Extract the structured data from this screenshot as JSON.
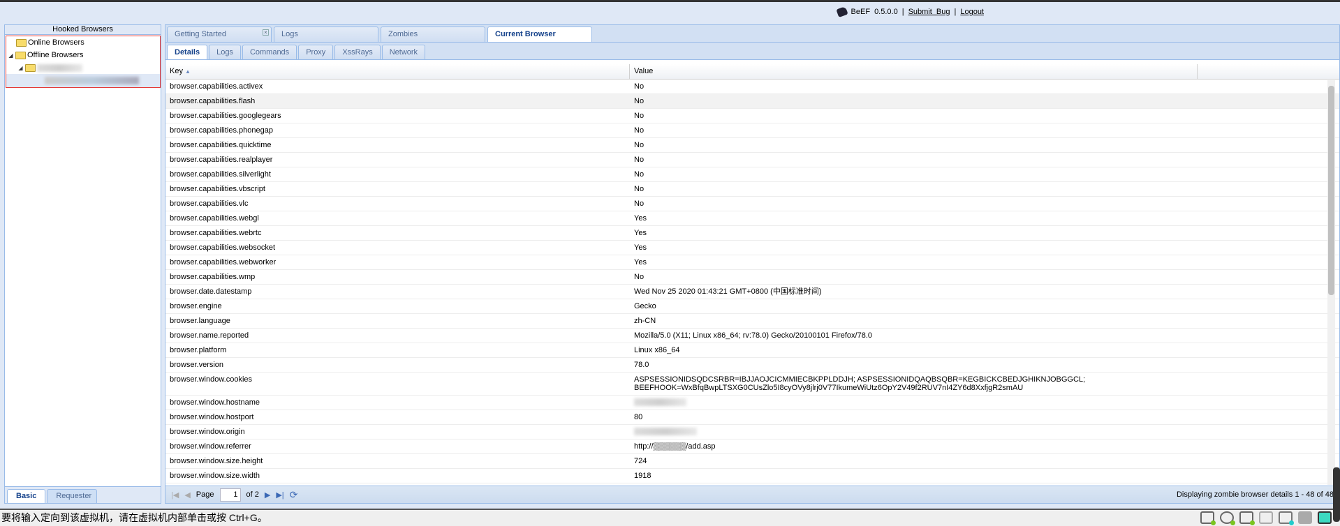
{
  "header": {
    "app": "BeEF",
    "version": "0.5.0.0",
    "submit_bug": "Submit  Bug",
    "logout": "Logout",
    "separator": "|"
  },
  "left": {
    "title": "Hooked Browsers",
    "tree": [
      {
        "label": "Online Browsers",
        "icon": "folder-icon"
      },
      {
        "label": "Offline Browsers",
        "icon": "folder-icon",
        "expanded": true
      }
    ],
    "tabs": [
      "Basic",
      "Requester"
    ]
  },
  "tabs": [
    "Getting Started",
    "Logs",
    "Zombies",
    "Current Browser"
  ],
  "subtabs": [
    "Details",
    "Logs",
    "Commands",
    "Proxy",
    "XssRays",
    "Network"
  ],
  "grid": {
    "columns": [
      "Key",
      "Value"
    ],
    "sort": "Key ascending",
    "rows": [
      [
        "browser.capabilities.activex",
        "No"
      ],
      [
        "browser.capabilities.flash",
        "No"
      ],
      [
        "browser.capabilities.googlegears",
        "No"
      ],
      [
        "browser.capabilities.phonegap",
        "No"
      ],
      [
        "browser.capabilities.quicktime",
        "No"
      ],
      [
        "browser.capabilities.realplayer",
        "No"
      ],
      [
        "browser.capabilities.silverlight",
        "No"
      ],
      [
        "browser.capabilities.vbscript",
        "No"
      ],
      [
        "browser.capabilities.vlc",
        "No"
      ],
      [
        "browser.capabilities.webgl",
        "Yes"
      ],
      [
        "browser.capabilities.webrtc",
        "Yes"
      ],
      [
        "browser.capabilities.websocket",
        "Yes"
      ],
      [
        "browser.capabilities.webworker",
        "Yes"
      ],
      [
        "browser.capabilities.wmp",
        "No"
      ],
      [
        "browser.date.datestamp",
        "Wed Nov 25 2020 01:43:21 GMT+0800 (中国标准时间)"
      ],
      [
        "browser.engine",
        "Gecko"
      ],
      [
        "browser.language",
        "zh-CN"
      ],
      [
        "browser.name.reported",
        "Mozilla/5.0 (X11; Linux x86_64; rv:78.0) Gecko/20100101 Firefox/78.0"
      ],
      [
        "browser.platform",
        "Linux x86_64"
      ],
      [
        "browser.version",
        "78.0"
      ],
      [
        "browser.window.cookies",
        "ASPSESSIONIDSQDCSRBR=IBJJAOJCICMMIECBKPPLDDJH; ASPSESSIONIDQAQBSQBR=KEGBICKCBEDJGHIKNJOBGGCL; BEEFHOOK=WxBfqBwpLTSXG0CUsZlo5I8cyOVy8jlrj0V77IkumeWiUtz6OpY2V49f2RUV7nI4ZY6d8XxfjgR2smAU"
      ],
      [
        "browser.window.hostname",
        ""
      ],
      [
        "browser.window.hostport",
        "80"
      ],
      [
        "browser.window.origin",
        ""
      ],
      [
        "browser.window.referrer",
        "http://▒▒▒▒▒▒/add.asp"
      ],
      [
        "browser.window.size.height",
        "724"
      ],
      [
        "browser.window.size.width",
        "1918"
      ]
    ]
  },
  "pager": {
    "page_label": "Page",
    "page": "1",
    "of": "of 2",
    "info": "Displaying zombie browser details 1 - 48 of 48"
  },
  "vm_status": "要将输入定向到该虚拟机，请在虚拟机内部单击或按 Ctrl+G。"
}
